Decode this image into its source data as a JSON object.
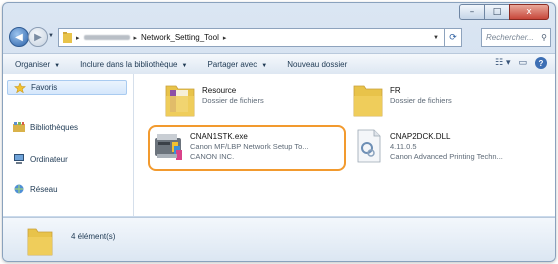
{
  "window": {
    "caption_buttons": {
      "minimize": "–",
      "maximize": "□",
      "close": "x"
    }
  },
  "address_bar": {
    "crumbs": [
      "Network_Setting_Tool"
    ],
    "search_placeholder": "Rechercher..."
  },
  "toolbar": {
    "items": [
      "Organiser",
      "Inclure dans la bibliothèque",
      "Partager avec",
      "Nouveau dossier"
    ]
  },
  "navigation": {
    "items": [
      {
        "label": "Favoris",
        "icon": "star-icon"
      },
      {
        "label": "Bibliothèques",
        "icon": "library-icon"
      },
      {
        "label": "Ordinateur",
        "icon": "computer-icon"
      },
      {
        "label": "Réseau",
        "icon": "network-icon"
      }
    ]
  },
  "files": [
    {
      "name": "Resource",
      "line2": "Dossier de fichiers",
      "line3": "",
      "icon": "folder-icon"
    },
    {
      "name": "FR",
      "line2": "Dossier de fichiers",
      "line3": "",
      "icon": "folder-icon"
    },
    {
      "name": "CNAN1STK.exe",
      "line2": "Canon MF/LBP Network Setup To...",
      "line3": "CANON INC.",
      "icon": "printer-app-icon",
      "selected": true
    },
    {
      "name": "CNAP2DCK.DLL",
      "line2": "4.11.0.5",
      "line3": "Canon Advanced Printing Techn...",
      "icon": "dll-file-icon"
    }
  ],
  "details_pane": {
    "item_count": "4 élément(s)"
  },
  "colors": {
    "selection_highlight": "#f29a2e",
    "folder": "#e8c34a",
    "accent": "#2c62a8"
  }
}
